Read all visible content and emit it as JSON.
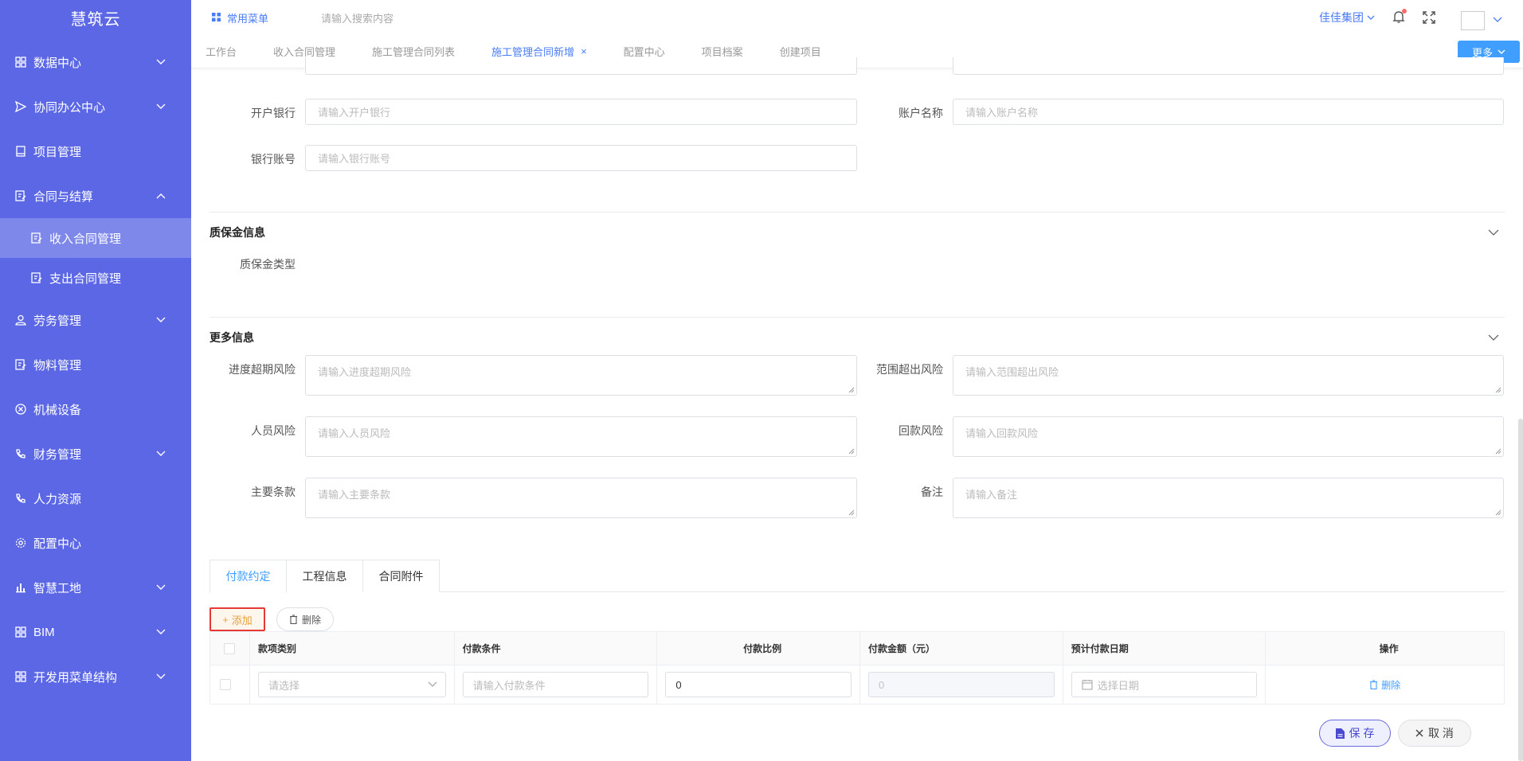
{
  "app": {
    "title": "慧筑云"
  },
  "sidebar": {
    "items": [
      {
        "label": "数据中心",
        "icon": "grid-icon",
        "chevron": "down"
      },
      {
        "label": "协同办公中心",
        "icon": "send-icon",
        "chevron": "down"
      },
      {
        "label": "项目管理",
        "icon": "book-icon",
        "chevron": ""
      },
      {
        "label": "合同与结算",
        "icon": "edit-doc-icon",
        "chevron": "up"
      },
      {
        "label": "劳务管理",
        "icon": "user-icon",
        "chevron": "down"
      },
      {
        "label": "物料管理",
        "icon": "edit-doc-icon",
        "chevron": ""
      },
      {
        "label": "机械设备",
        "icon": "circle-x-icon",
        "chevron": ""
      },
      {
        "label": "财务管理",
        "icon": "phone-icon",
        "chevron": "down"
      },
      {
        "label": "人力资源",
        "icon": "phone-icon",
        "chevron": ""
      },
      {
        "label": "配置中心",
        "icon": "gear-icon",
        "chevron": ""
      },
      {
        "label": "智慧工地",
        "icon": "bar-chart-icon",
        "chevron": "down"
      },
      {
        "label": "BIM",
        "icon": "grid-icon",
        "chevron": "down"
      },
      {
        "label": "开发用菜单结构",
        "icon": "grid-icon",
        "chevron": "down"
      }
    ],
    "subitems": [
      {
        "label": "收入合同管理",
        "active": true
      },
      {
        "label": "支出合同管理",
        "active": false
      }
    ]
  },
  "topbar": {
    "favorites": "常用菜单",
    "search_placeholder": "请输入搜索内容",
    "org": "佳佳集团"
  },
  "tabs": [
    {
      "label": "工作台",
      "active": false
    },
    {
      "label": "收入合同管理",
      "active": false
    },
    {
      "label": "施工管理合同列表",
      "active": false
    },
    {
      "label": "施工管理合同新增",
      "active": true
    },
    {
      "label": "配置中心",
      "active": false
    },
    {
      "label": "项目档案",
      "active": false
    },
    {
      "label": "创建项目",
      "active": false
    }
  ],
  "more_label": "更多",
  "form": {
    "bank_label": "开户银行",
    "bank_placeholder": "请输入开户银行",
    "account_name_label": "账户名称",
    "account_name_placeholder": "请输入账户名称",
    "account_no_label": "银行账号",
    "account_no_placeholder": "请输入银行账号"
  },
  "warranty": {
    "title": "质保金信息",
    "type_label": "质保金类型"
  },
  "more_info": {
    "title": "更多信息",
    "fields": [
      {
        "label": "进度超期风险",
        "placeholder": "请输入进度超期风险"
      },
      {
        "label": "范围超出风险",
        "placeholder": "请输入范围超出风险"
      },
      {
        "label": "人员风险",
        "placeholder": "请输入人员风险"
      },
      {
        "label": "回款风险",
        "placeholder": "请输入回款风险"
      },
      {
        "label": "主要条款",
        "placeholder": "请输入主要条款"
      },
      {
        "label": "备注",
        "placeholder": "请输入备注"
      }
    ]
  },
  "panel_tabs": [
    {
      "label": "付款约定",
      "active": true
    },
    {
      "label": "工程信息",
      "active": false
    },
    {
      "label": "合同附件",
      "active": false
    }
  ],
  "actions": {
    "add": "添加",
    "delete": "删除"
  },
  "table": {
    "headers": [
      "款项类别",
      "付款条件",
      "付款比例",
      "付款金额（元）",
      "预计付款日期",
      "操作"
    ],
    "row": {
      "category_placeholder": "请选择",
      "condition_placeholder": "请输入付款条件",
      "ratio": "0",
      "amount": "0",
      "date_placeholder": "选择日期",
      "op_delete": "删除"
    }
  },
  "footer": {
    "save": "保 存",
    "cancel": "取 消"
  },
  "colors": {
    "sidebar": "#5b67e4",
    "accent": "#409eff",
    "warning": "#e6a23c"
  }
}
